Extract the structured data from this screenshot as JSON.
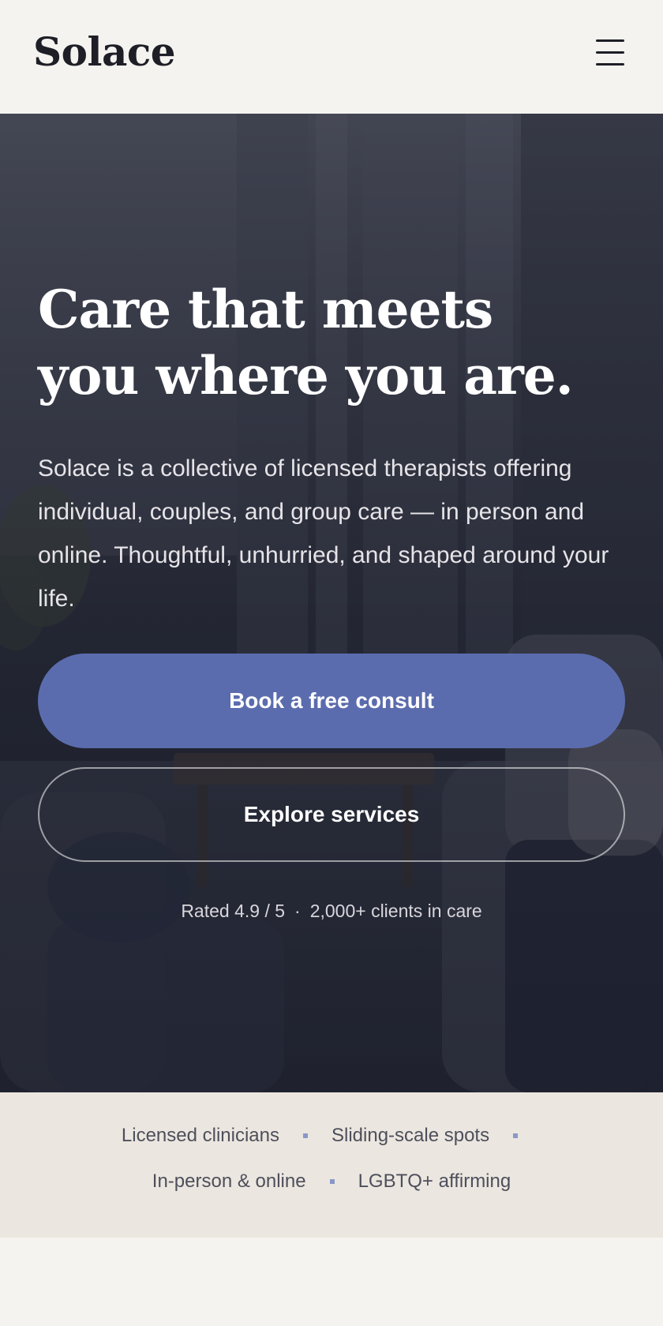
{
  "header": {
    "logo": "Solace",
    "menu_icon": "hamburger-menu-icon"
  },
  "hero": {
    "title_line1": "Care that meets",
    "title_line2": "you where you are.",
    "description": "Solace is a collective of licensed therapists offering individual, couples, and group care — in person and online. Thoughtful, unhurried, and shaped around your life.",
    "primary_cta": "Book a free consult",
    "secondary_cta": "Explore services",
    "rating": "Rated 4.9 / 5",
    "separator": "·",
    "clients": "2,000+ clients in care"
  },
  "features": {
    "items": [
      "Licensed clinicians",
      "Sliding-scale spots",
      "In-person & online",
      "LGBTQ+ affirming"
    ]
  },
  "colors": {
    "primary": "#5b6cae",
    "background": "#f5f3ef",
    "strip": "#ebe6df",
    "text_dark": "#1d1e26"
  }
}
